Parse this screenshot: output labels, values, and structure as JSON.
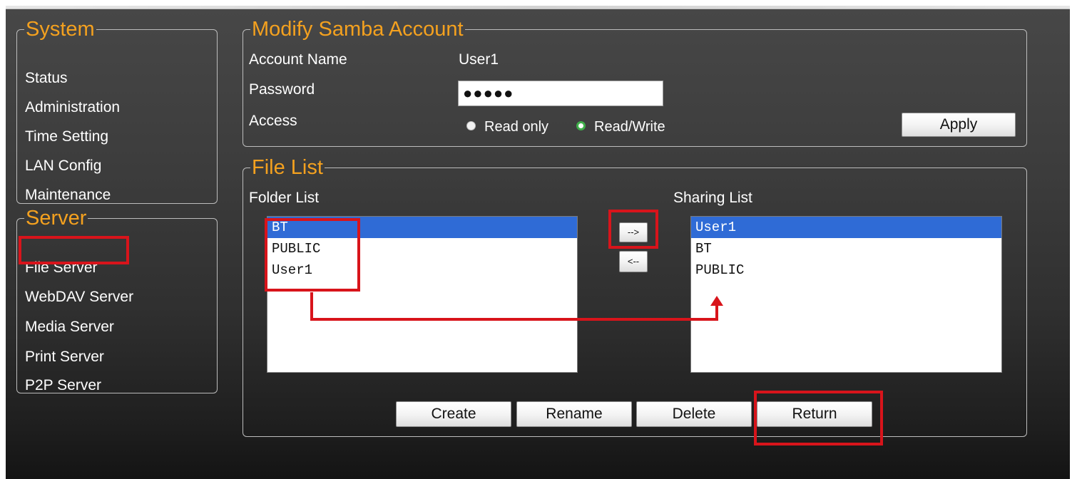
{
  "system": {
    "legend": "System",
    "items": [
      "Status",
      "Administration",
      "Time Setting",
      "LAN Config",
      "Maintenance"
    ]
  },
  "server": {
    "legend": "Server",
    "items": [
      "File Server",
      "WebDAV Server",
      "Media Server",
      "Print Server",
      "P2P Server"
    ]
  },
  "account": {
    "legend": "Modify Samba Account",
    "name_label": "Account Name",
    "name_value": "User1",
    "password_label": "Password",
    "password_value": "●●●●●",
    "access_label": "Access",
    "read_only_label": "Read only",
    "read_write_label": "Read/Write",
    "apply_label": "Apply"
  },
  "files": {
    "legend": "File List",
    "folder_list_label": "Folder List",
    "sharing_list_label": "Sharing List",
    "folder_list": [
      "BT",
      "PUBLIC",
      "User1"
    ],
    "sharing_list": [
      "User1",
      "BT",
      "PUBLIC"
    ],
    "add_label": "-->",
    "remove_label": "<--",
    "create_label": "Create",
    "rename_label": "Rename",
    "delete_label": "Delete",
    "return_label": "Return"
  },
  "colors": {
    "legend": "#f4a11f",
    "highlight": "#d8141b",
    "selection": "#2f6bd6"
  }
}
